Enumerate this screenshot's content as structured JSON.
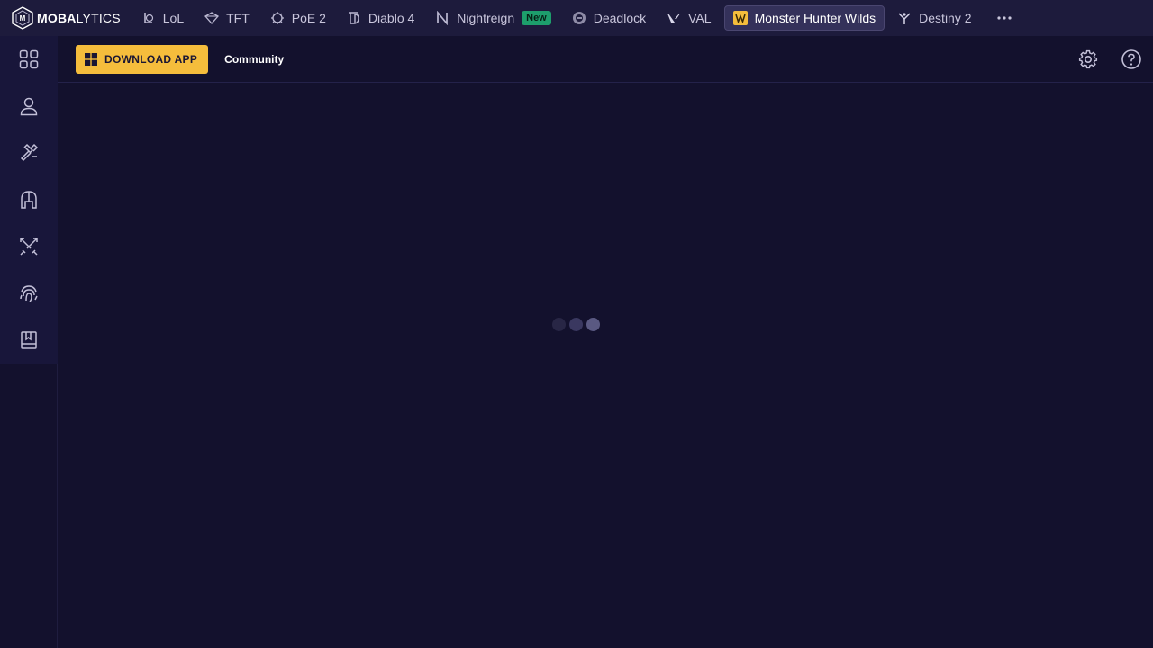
{
  "brand": {
    "bold": "MOBA",
    "light": "LYTICS"
  },
  "games": [
    {
      "label": "LoL",
      "icon": "lol-icon"
    },
    {
      "label": "TFT",
      "icon": "tft-icon"
    },
    {
      "label": "PoE 2",
      "icon": "poe2-icon"
    },
    {
      "label": "Diablo 4",
      "icon": "diablo4-icon"
    },
    {
      "label": "Nightreign",
      "icon": "nightreign-icon",
      "badge": "New"
    },
    {
      "label": "Deadlock",
      "icon": "deadlock-icon"
    },
    {
      "label": "VAL",
      "icon": "valorant-icon"
    },
    {
      "label": "Monster Hunter Wilds",
      "icon": "monster-hunter-wilds-icon",
      "active": true
    },
    {
      "label": "Destiny 2",
      "icon": "destiny2-icon"
    }
  ],
  "more_icon": "ellipsis-icon",
  "sidebar": {
    "items": [
      {
        "icon": "grid-icon"
      },
      {
        "icon": "user-icon"
      },
      {
        "icon": "hammer-icon"
      },
      {
        "icon": "helmet-icon"
      },
      {
        "icon": "crossed-swords-icon"
      },
      {
        "icon": "fingerprint-icon"
      },
      {
        "icon": "book-icon"
      }
    ]
  },
  "subheader": {
    "download_label": "DOWNLOAD APP",
    "community_label": "Community"
  },
  "colors": {
    "accent": "#f5bd3c",
    "background": "#13112d",
    "topbar": "#1d1b3c",
    "new_badge": "#1d9e6c"
  }
}
